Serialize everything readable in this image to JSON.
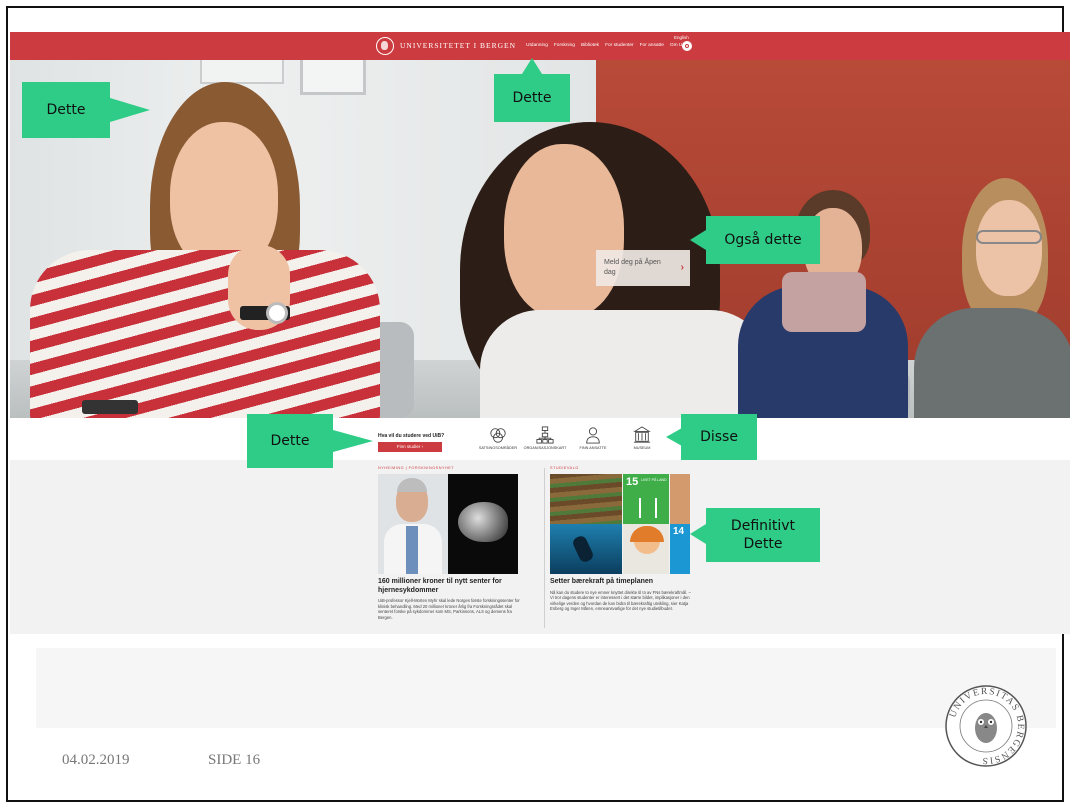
{
  "site": {
    "logo_text": "UNIVERSITETET I BERGEN",
    "nav": [
      "Utdanning",
      "Forskning",
      "Bibliotek",
      "For studenter",
      "For ansatte",
      "Om UiB"
    ],
    "nav_more_symbol": "▾",
    "english_label": "English"
  },
  "hero": {
    "cta_label": "Meld deg på Åpen dag",
    "cta_arrow": "›"
  },
  "quickbar": {
    "question": "Hva vil du studere ved UiB?",
    "button_label": "Finn studier",
    "button_arrow": "›",
    "items": [
      {
        "label": "SATSINGSOMRÅDER",
        "icon": "circles-icon"
      },
      {
        "label": "ORGANISASJONSKART",
        "icon": "org-chart-icon"
      },
      {
        "label": "FINN ANSATTE",
        "icon": "person-icon"
      },
      {
        "label": "MUSEUM",
        "icon": "museum-icon"
      }
    ]
  },
  "news": [
    {
      "kicker": "NYHEIMING | FORSKNINGSNYHET",
      "title": "160 millioner kroner til nytt senter for hjernesykdommer",
      "body": "UiB-professor Kjell-Morten Myhr skal lede Norges første forskningssenter for klinisk behandling. Med 20 millioner kroner årlig fra Forskningsrådet skal senteret forske på sykdommer som MS, Parkinsons, ALS og demens fra Bergen."
    },
    {
      "kicker": "STUDIEVALG",
      "title": "Setter bærekraft på timeplanen",
      "body": "Nå kan du studere to nye emner knyttet direkte til to av FNs bærekraftmål. – Vi tror dagens studenter er interessert i det større bildet, implikasjoner i den virkelige verden og hvordan de kan bidra til bærekraftig utvikling, sier Katja Enberg og Inger Måren, emneansvarlige for det nye studietilbudet.",
      "sdg_numbers": [
        "15",
        "14"
      ],
      "sdg_caption": "LIVET PÅ LAND"
    }
  ],
  "callouts": [
    {
      "text": "Dette"
    },
    {
      "text": "Dette"
    },
    {
      "text": "Også dette"
    },
    {
      "text": "Dette"
    },
    {
      "text": "Disse"
    },
    {
      "text": "Definitivt Dette"
    }
  ],
  "footer": {
    "date": "04.02.2019",
    "page": "SIDE 16",
    "seal_text": "UNIVERSITAS BERGENSIS"
  },
  "colors": {
    "brand_red": "#cc3b3f",
    "callout_green": "#2ecc87"
  }
}
